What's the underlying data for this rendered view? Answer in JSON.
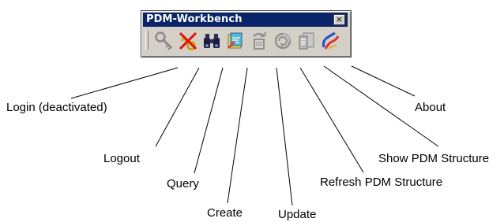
{
  "window": {
    "title": "PDM-Workbench",
    "close_glyph": "×"
  },
  "toolbar": {
    "buttons": [
      {
        "icon": "login-key-icon",
        "state": "deactivated"
      },
      {
        "icon": "logout-key-icon",
        "state": "enabled"
      },
      {
        "icon": "binoculars-query-icon",
        "state": "enabled"
      },
      {
        "icon": "create-icon",
        "state": "enabled"
      },
      {
        "icon": "update-icon",
        "state": "disabled"
      },
      {
        "icon": "refresh-icon",
        "state": "disabled"
      },
      {
        "icon": "pdm-structure-icon",
        "state": "disabled"
      },
      {
        "icon": "about-icon",
        "state": "enabled"
      }
    ]
  },
  "labels": {
    "login": "Login (deactivated)",
    "logout": "Logout",
    "query": "Query",
    "create": "Create",
    "update": "Update",
    "refresh": "Refresh PDM Structure",
    "show": "Show PDM Structure",
    "about": "About"
  },
  "colors": {
    "title_bar": "#0a246a",
    "face": "#d4d0c8"
  }
}
